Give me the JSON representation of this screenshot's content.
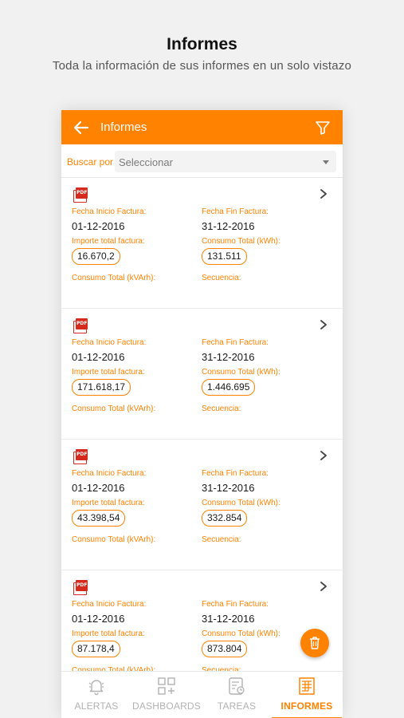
{
  "promo": {
    "title": "Informes",
    "subtitle": "Toda la información de sus informes en un solo vistazo"
  },
  "appbar": {
    "title": "Informes"
  },
  "search": {
    "label": "Buscar por",
    "selected": "Seleccionar"
  },
  "labels": {
    "fecha_inicio": "Fecha Inicio Factura:",
    "fecha_fin": "Fecha Fin Factura:",
    "importe": "Importe total factura:",
    "consumo_kwh": "Consumo Total (kWh):",
    "consumo_kvarh": "Consumo Total (kVArh):",
    "secuencia": "Secuencia:"
  },
  "cards": [
    {
      "fecha_inicio": "01-12-2016",
      "fecha_fin": "31-12-2016",
      "importe": "16.670,2",
      "consumo_kwh": "131.511"
    },
    {
      "fecha_inicio": "01-12-2016",
      "fecha_fin": "31-12-2016",
      "importe": "171.618,17",
      "consumo_kwh": "1.446.695"
    },
    {
      "fecha_inicio": "01-12-2016",
      "fecha_fin": "31-12-2016",
      "importe": "43.398,54",
      "consumo_kwh": "332.854"
    },
    {
      "fecha_inicio": "01-12-2016",
      "fecha_fin": "31-12-2016",
      "importe": "87.178,4",
      "consumo_kwh": "873.804"
    }
  ],
  "pdf_badge": "PDF",
  "nav": {
    "alertas": "ALERTAS",
    "dashboards": "DASHBOARDS",
    "tareas": "TAREAS",
    "informes": "INFORMES",
    "active": "informes"
  },
  "colors": {
    "accent": "#ff8200",
    "pdf_red": "#d52b1e",
    "inactive": "#b2b2b2"
  },
  "icons": {
    "back": "arrow-left-icon",
    "filter": "funnel-icon",
    "pdf": "pdf-file-icon",
    "chevron": "chevron-right-icon",
    "fab": "trash-icon"
  }
}
